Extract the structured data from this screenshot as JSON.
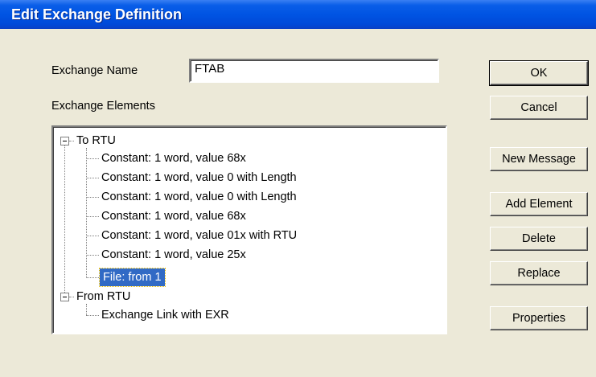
{
  "dialog": {
    "title": "Edit Exchange Definition"
  },
  "form": {
    "exchange_name_label": "Exchange Name",
    "exchange_name_value": "FTAB",
    "exchange_elements_label": "Exchange Elements"
  },
  "tree": {
    "groups": [
      {
        "label": "To RTU",
        "expanded": true,
        "children": [
          "Constant: 1 word, value 68x",
          "Constant: 1 word, value 0 with Length",
          "Constant: 1 word, value 0 with Length",
          "Constant: 1 word, value 68x",
          "Constant: 1 word, value 01x with RTU",
          "Constant: 1 word, value 25x",
          "File:  from 1"
        ]
      },
      {
        "label": "From RTU",
        "expanded": true,
        "children": [
          "Exchange Link with EXR"
        ]
      }
    ],
    "selected_item": "File:  from 1"
  },
  "buttons": {
    "ok": "OK",
    "cancel": "Cancel",
    "new_message": "New Message",
    "add_element": "Add Element",
    "delete": "Delete",
    "replace": "Replace",
    "properties": "Properties"
  },
  "colors": {
    "titlebar": "#0054e3",
    "dialog_bg": "#ece9d8",
    "selection": "#316ac5"
  }
}
